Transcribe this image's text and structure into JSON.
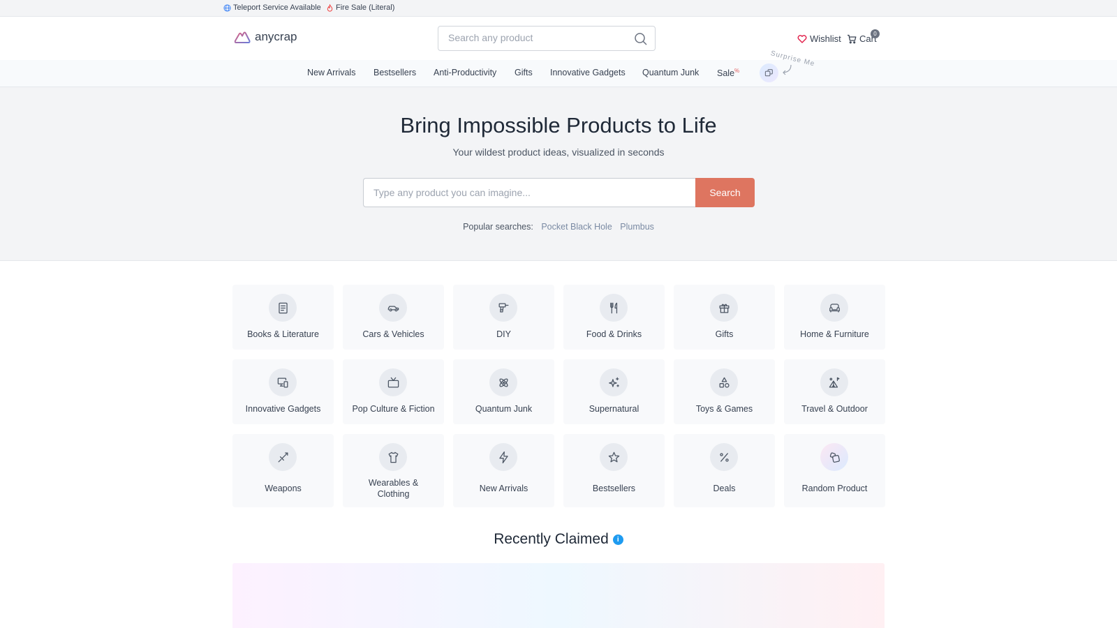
{
  "topbar": {
    "teleport": "Teleport Service Available",
    "firesale": "Fire Sale (Literal)"
  },
  "header": {
    "logo_text": "anycrap",
    "search_placeholder": "Search any product",
    "wishlist": "Wishlist",
    "cart": "Cart",
    "cart_count": "0"
  },
  "nav": {
    "items": [
      "New Arrivals",
      "Bestsellers",
      "Anti-Productivity",
      "Gifts",
      "Innovative Gadgets",
      "Quantum Junk",
      "Sale"
    ],
    "sale_badge": "%",
    "surprise_label": "Surprise Me"
  },
  "hero": {
    "title": "Bring Impossible Products to Life",
    "subtitle": "Your wildest product ideas, visualized in seconds",
    "search_placeholder": "Type any product you can imagine...",
    "search_button": "Search",
    "popular_label": "Popular searches:",
    "popular": [
      "Pocket Black Hole",
      "Plumbus"
    ]
  },
  "categories": [
    {
      "label": "Books & Literature",
      "icon": "book-icon"
    },
    {
      "label": "Cars & Vehicles",
      "icon": "car-icon"
    },
    {
      "label": "DIY",
      "icon": "drill-icon"
    },
    {
      "label": "Food & Drinks",
      "icon": "utensils-icon"
    },
    {
      "label": "Gifts",
      "icon": "gift-icon"
    },
    {
      "label": "Home & Furniture",
      "icon": "sofa-icon"
    },
    {
      "label": "Innovative Gadgets",
      "icon": "devices-icon"
    },
    {
      "label": "Pop Culture & Fiction",
      "icon": "tv-icon"
    },
    {
      "label": "Quantum Junk",
      "icon": "atom-icon"
    },
    {
      "label": "Supernatural",
      "icon": "sparkles-icon"
    },
    {
      "label": "Toys & Games",
      "icon": "shapes-icon"
    },
    {
      "label": "Travel & Outdoor",
      "icon": "tent-icon"
    },
    {
      "label": "Weapons",
      "icon": "sword-icon"
    },
    {
      "label": "Wearables & Clothing",
      "icon": "shirt-icon"
    },
    {
      "label": "New Arrivals",
      "icon": "zap-icon"
    },
    {
      "label": "Bestsellers",
      "icon": "star-icon"
    },
    {
      "label": "Deals",
      "icon": "percent-icon"
    },
    {
      "label": "Random Product",
      "icon": "dice-icon"
    }
  ],
  "recently_claimed": {
    "title": "Recently Claimed",
    "info": "i"
  },
  "colors": {
    "accent": "#de7560",
    "info": "#1e9bf0",
    "link": "#7a8aa3"
  }
}
